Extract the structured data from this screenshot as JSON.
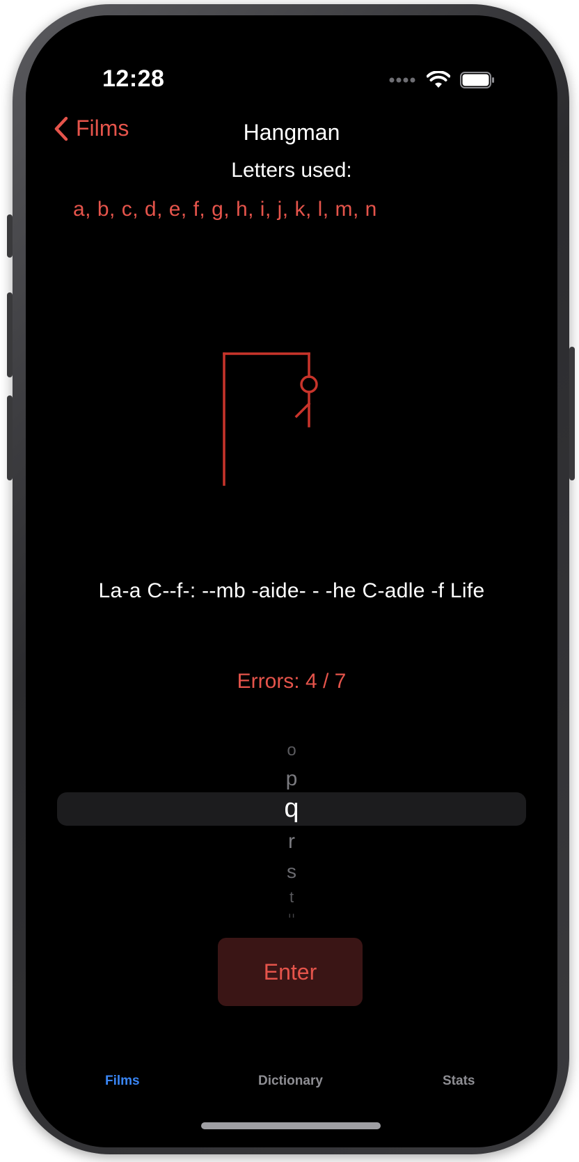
{
  "status_bar": {
    "time": "12:28"
  },
  "nav": {
    "back_label": "Films",
    "title": "Hangman"
  },
  "game": {
    "letters_used_title": "Letters used:",
    "letters_used": "a, b, c, d, e, f, g, h, i, j, k, l, m, n",
    "puzzle": "La-a C--f-: --mb -aide- - -he C-adle -f Life",
    "errors": "Errors: 4 / 7",
    "errors_count": 4,
    "errors_max": 7
  },
  "picker": {
    "above": [
      "o",
      "p"
    ],
    "selected": "q",
    "below": [
      "r",
      "s",
      "t",
      "u"
    ]
  },
  "enter_label": "Enter",
  "tabs": [
    {
      "label": "Films",
      "active": true
    },
    {
      "label": "Dictionary",
      "active": false
    },
    {
      "label": "Stats",
      "active": false
    }
  ],
  "colors": {
    "accent": "#e5544b",
    "tab_active": "#3a86f5",
    "background": "#000000"
  }
}
